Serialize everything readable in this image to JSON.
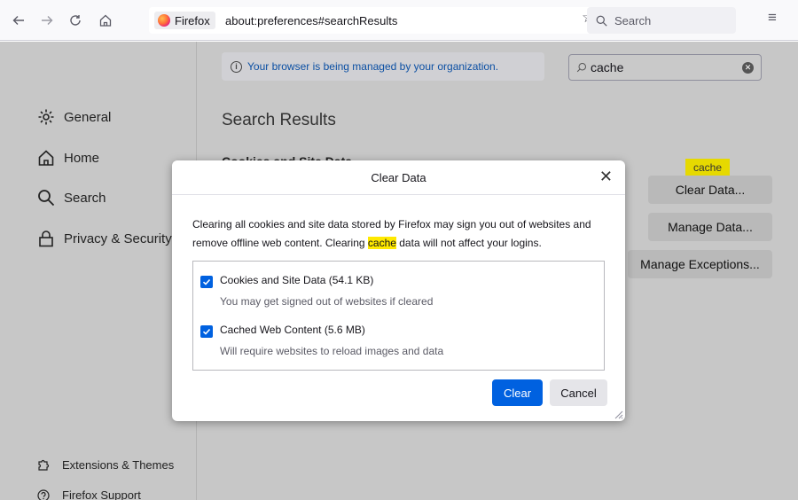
{
  "browser": {
    "identity_label": "Firefox",
    "url": "about:preferences#searchResults",
    "search_placeholder": "Search"
  },
  "sidebar": {
    "items": [
      {
        "label": "General",
        "icon": "gear-icon"
      },
      {
        "label": "Home",
        "icon": "home-icon"
      },
      {
        "label": "Search",
        "icon": "search-icon"
      },
      {
        "label": "Privacy & Security",
        "icon": "lock-icon"
      }
    ],
    "footer": [
      {
        "label": "Extensions & Themes",
        "icon": "puzzle-icon"
      },
      {
        "label": "Firefox Support",
        "icon": "help-icon"
      }
    ]
  },
  "main": {
    "policy_notice": "Your browser is being managed by your organization.",
    "find_value": "cache",
    "results_title": "Search Results",
    "section_title": "Cookies and Site Data",
    "tooltip": "cache",
    "buttons": {
      "clear_data": "Clear Data...",
      "manage_data": "Manage Data...",
      "manage_exceptions": "Manage Exceptions..."
    }
  },
  "dialog": {
    "title": "Clear Data",
    "desc_1": "Clearing all cookies and site data stored by Firefox may sign you out of websites and remove offline web content. Clearing ",
    "desc_hl": "cache",
    "desc_2": " data will not affect your logins.",
    "options": [
      {
        "label": "Cookies and Site Data (54.1 KB)",
        "sub": "You may get signed out of websites if cleared",
        "checked": true
      },
      {
        "label": "Cached Web Content (5.6 MB)",
        "sub": "Will require websites to reload images and data",
        "checked": true
      }
    ],
    "clear_label": "Clear",
    "cancel_label": "Cancel"
  },
  "colors": {
    "accent": "#0061e0",
    "highlight": "#ffe900"
  }
}
